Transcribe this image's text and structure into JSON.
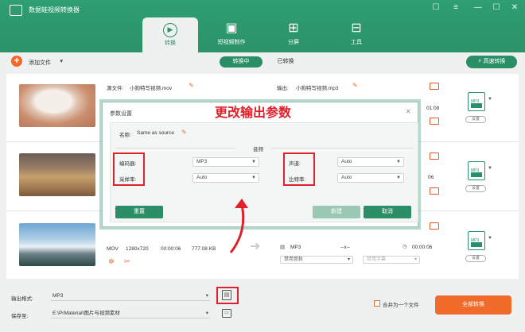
{
  "app": {
    "title": "数据蛙视频转换器"
  },
  "window_controls": {
    "chat": "☐",
    "menu": "≡",
    "minimize": "—",
    "maximize": "☐",
    "close": "✕"
  },
  "tabs": [
    {
      "label": "转换",
      "icon": "convert-icon"
    },
    {
      "label": "短视频制作",
      "icon": "film-icon"
    },
    {
      "label": "分屏",
      "icon": "split-screen-icon"
    },
    {
      "label": "工具",
      "icon": "toolbox-icon"
    }
  ],
  "toolbar": {
    "add_label": "添加文件",
    "seg_converting": "转换中",
    "seg_converted": "已转换",
    "fast_label": "高速转换"
  },
  "row1": {
    "src_label": "源文件:",
    "src_name": "小狗特写视频.mov",
    "out_label": "输出:",
    "out_name": "小狗特写视频.mp3",
    "badge": "MP3",
    "duration_partial": "01:08",
    "set_label": "设置"
  },
  "row2": {
    "badge": "MP3",
    "duration_partial": "06",
    "set_label": "设置"
  },
  "row3": {
    "format": "MOV",
    "resolution": "1280x720",
    "duration": "00:00:06",
    "size": "777.08 KB",
    "out_format": "MP3",
    "out_res": "--x--",
    "out_duration": "00:00:06",
    "audio_dd": "禁用音轨",
    "subtitle_dd": "禁用字幕",
    "badge": "MP3",
    "set_label": "设置"
  },
  "bottom": {
    "format_label": "输出格式:",
    "format_value": "MP3",
    "save_label": "保存至:",
    "save_value": "E:\\PrMaterial\\图片与视频素材",
    "merge_label": "合并为一个文件",
    "convert_all": "全部转换"
  },
  "dialog": {
    "title": "参数设置",
    "name_label": "名称:",
    "name_value": "Same as source",
    "section": "音频",
    "encoder_label": "编码器:",
    "encoder_value": "MP3",
    "samplerate_label": "采样率:",
    "samplerate_value": "Auto",
    "channel_label": "声道:",
    "channel_value": "Auto",
    "bitrate_label": "比特率:",
    "bitrate_value": "Auto",
    "btn_create": "重置",
    "btn_new": "新建",
    "btn_cancel": "取消"
  },
  "annotation": "更改输出参数",
  "colors": {
    "brand": "#2a8f67",
    "accent": "#f06a2a",
    "highlight": "#e0202a"
  }
}
